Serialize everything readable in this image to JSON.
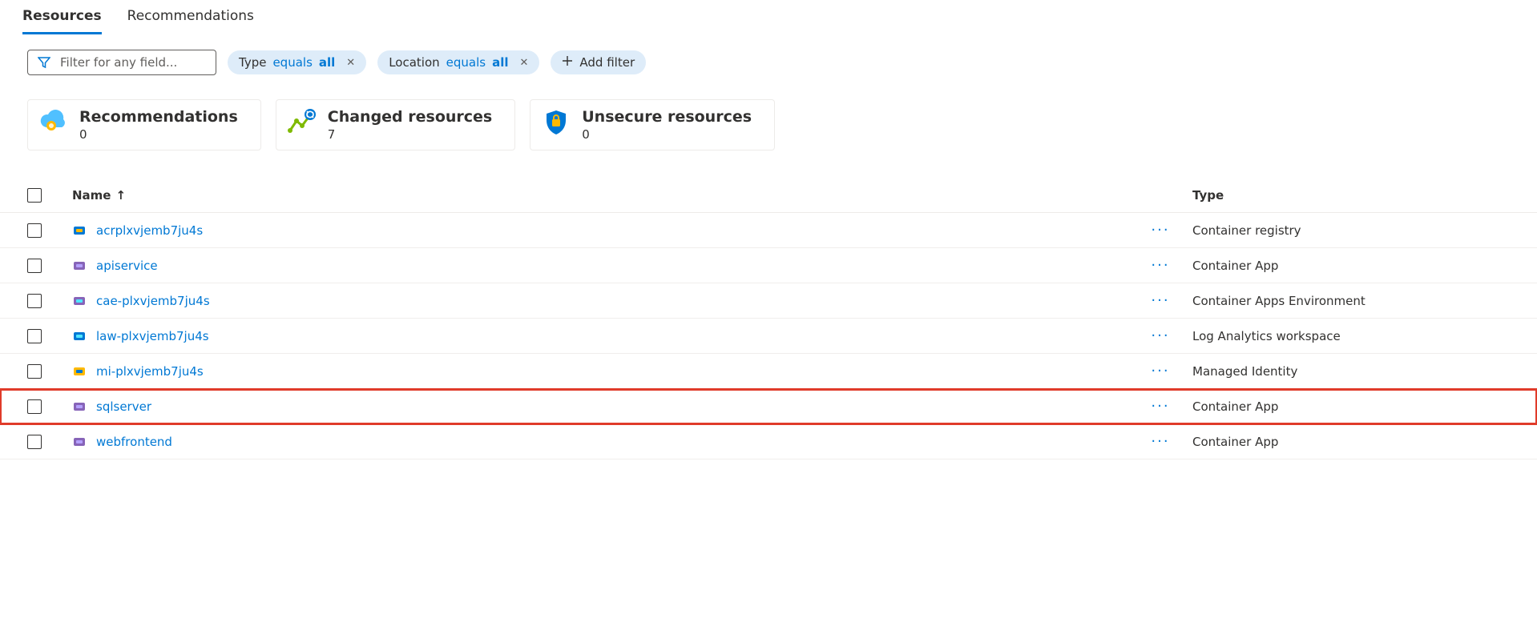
{
  "tabs": [
    {
      "label": "Resources",
      "active": true
    },
    {
      "label": "Recommendations",
      "active": false
    }
  ],
  "filter": {
    "placeholder": "Filter for any field..."
  },
  "pills": [
    {
      "field": "Type",
      "op": "equals",
      "val": "all"
    },
    {
      "field": "Location",
      "op": "equals",
      "val": "all"
    }
  ],
  "addFilterLabel": "Add filter",
  "cards": {
    "recommendations": {
      "title": "Recommendations",
      "count": "0"
    },
    "changed": {
      "title": "Changed resources",
      "count": "7"
    },
    "unsecure": {
      "title": "Unsecure resources",
      "count": "0"
    }
  },
  "columns": {
    "name": "Name",
    "type": "Type"
  },
  "rows": [
    {
      "name": "acrplxvjemb7ju4s",
      "type": "Container registry",
      "iconColor1": "#0078d4",
      "iconColor2": "#ffb900",
      "highlight": false
    },
    {
      "name": "apiservice",
      "type": "Container App",
      "iconColor1": "#8764b8",
      "iconColor2": "#b4a0ff",
      "highlight": false
    },
    {
      "name": "cae-plxvjemb7ju4s",
      "type": "Container Apps Environment",
      "iconColor1": "#8764b8",
      "iconColor2": "#50e6ff",
      "highlight": false
    },
    {
      "name": "law-plxvjemb7ju4s",
      "type": "Log Analytics workspace",
      "iconColor1": "#0078d4",
      "iconColor2": "#50e6ff",
      "highlight": false
    },
    {
      "name": "mi-plxvjemb7ju4s",
      "type": "Managed Identity",
      "iconColor1": "#ffb900",
      "iconColor2": "#0078d4",
      "highlight": false
    },
    {
      "name": "sqlserver",
      "type": "Container App",
      "iconColor1": "#8764b8",
      "iconColor2": "#b4a0ff",
      "highlight": true
    },
    {
      "name": "webfrontend",
      "type": "Container App",
      "iconColor1": "#8764b8",
      "iconColor2": "#b4a0ff",
      "highlight": false
    }
  ]
}
